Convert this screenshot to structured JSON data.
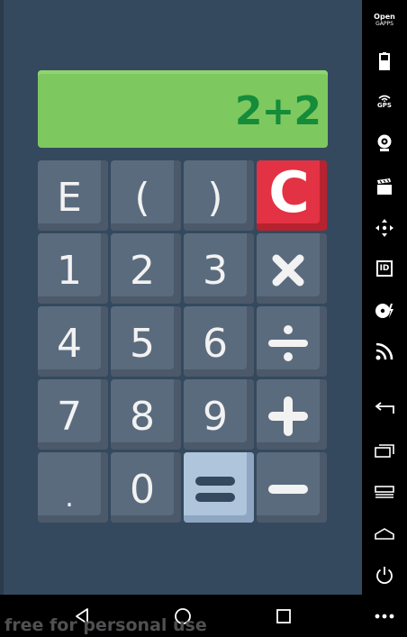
{
  "display": {
    "expression": "2+2"
  },
  "keys": {
    "e": "E",
    "open_paren": "(",
    "close_paren": ")",
    "clear": "C",
    "one": "1",
    "two": "2",
    "three": "3",
    "four": "4",
    "five": "5",
    "six": "6",
    "seven": "7",
    "eight": "8",
    "nine": "9",
    "dot": ".",
    "zero": "0"
  },
  "sidebar": {
    "open_gapps_line1": "Open",
    "open_gapps_line2": "GAPPS",
    "gps_label": "GPS",
    "id_label": "ID"
  },
  "watermark": "free for personal use",
  "colors": {
    "background": "#34495e",
    "key": "#5b6b7e",
    "display": "#7ec860",
    "display_text": "#148c3a",
    "clear_key": "#e33243",
    "equals_key": "#aec5dc"
  }
}
